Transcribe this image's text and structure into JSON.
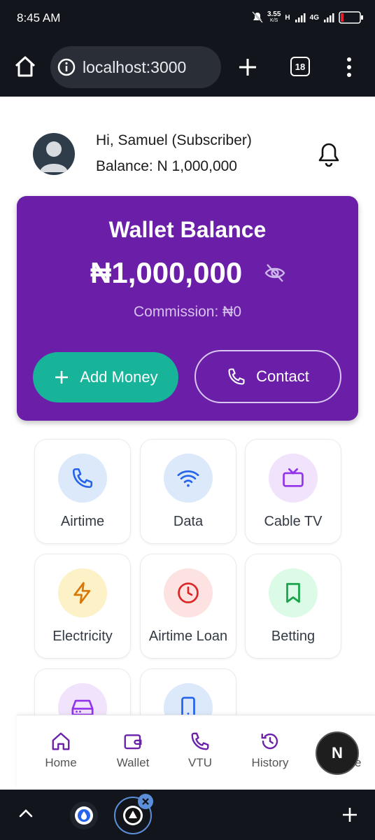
{
  "status_bar": {
    "time": "8:45 AM",
    "net_speed": "3.55",
    "net_unit": "K/S",
    "network_h": "H",
    "network_4g": "4G"
  },
  "browser": {
    "url": "localhost:3000",
    "tab_count": "18"
  },
  "header": {
    "greeting": "Hi, Samuel (Subscriber)",
    "balance_line": "Balance: N 1,000,000"
  },
  "wallet": {
    "title": "Wallet Balance",
    "amount": "₦1,000,000",
    "commission": "Commission: ₦0",
    "add_money_label": "Add Money",
    "contact_label": "Contact"
  },
  "services": [
    {
      "label": "Airtime",
      "icon": "phone-icon",
      "bg": "#dbe9fb",
      "color": "#2563eb"
    },
    {
      "label": "Data",
      "icon": "wifi-icon",
      "bg": "#dbe9fb",
      "color": "#2563eb"
    },
    {
      "label": "Cable TV",
      "icon": "tv-icon",
      "bg": "#f1e3fb",
      "color": "#9333ea"
    },
    {
      "label": "Electricity",
      "icon": "bolt-icon",
      "bg": "#fdf1c7",
      "color": "#d97706"
    },
    {
      "label": "Airtime Loan",
      "icon": "clock-icon",
      "bg": "#fde2e2",
      "color": "#dc2626"
    },
    {
      "label": "Betting",
      "icon": "bookmark-icon",
      "bg": "#dcfbe6",
      "color": "#16a34a"
    },
    {
      "label": "",
      "icon": "drive-icon",
      "bg": "#f1e3fb",
      "color": "#9333ea"
    },
    {
      "label": "",
      "icon": "smartphone-icon",
      "bg": "#dbe9fb",
      "color": "#2563eb"
    }
  ],
  "bottom_nav": [
    {
      "label": "Home",
      "icon": "home-icon"
    },
    {
      "label": "Wallet",
      "icon": "wallet-icon"
    },
    {
      "label": "VTU",
      "icon": "phone-icon"
    },
    {
      "label": "History",
      "icon": "history-icon"
    },
    {
      "label": "ile",
      "icon": "profile-icon"
    }
  ],
  "next_badge": "N",
  "colors": {
    "card": "#6b1fa8",
    "accent": "#17b49a",
    "nav_icon": "#6b21a8"
  }
}
